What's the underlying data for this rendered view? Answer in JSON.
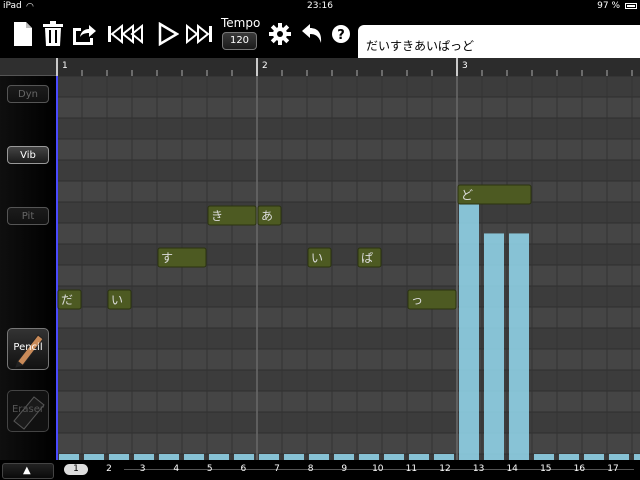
{
  "status": {
    "device": "iPad",
    "time": "23:16",
    "battery": "97 %"
  },
  "toolbar": {
    "tempo_label": "Tempo",
    "tempo_value": "120",
    "lyrics_value": "だいすきあいぱっど"
  },
  "sidebar": {
    "dyn": "Dyn",
    "vib": "Vib",
    "pit": "Pit",
    "pencil": "Pencil",
    "eraser": "Eraser"
  },
  "ruler": {
    "measures": [
      "1",
      "2",
      "3"
    ]
  },
  "notes": [
    {
      "char": "だ",
      "step": 0,
      "len": 1,
      "row": 10
    },
    {
      "char": "い",
      "step": 2,
      "len": 1,
      "row": 10
    },
    {
      "char": "す",
      "step": 4,
      "len": 2,
      "row": 8
    },
    {
      "char": "き",
      "step": 6,
      "len": 2,
      "row": 6
    },
    {
      "char": "あ",
      "step": 8,
      "len": 1,
      "row": 6
    },
    {
      "char": "い",
      "step": 10,
      "len": 1,
      "row": 8
    },
    {
      "char": "ぱ",
      "step": 12,
      "len": 1,
      "row": 8
    },
    {
      "char": "っ",
      "step": 14,
      "len": 2,
      "row": 10
    },
    {
      "char": "ど",
      "step": 16,
      "len": 3,
      "row": 5
    }
  ],
  "parameter_bars": {
    "note": "level per step, 0-1",
    "levels": [
      0.01,
      0.01,
      0.01,
      0.01,
      0.01,
      0.01,
      0.01,
      0.01,
      0.01,
      0.01,
      0.01,
      0.01,
      0.01,
      0.01,
      0.01,
      0.01,
      0.67,
      0.59,
      0.59,
      0.01,
      0.01,
      0.01,
      0.01,
      0.01
    ]
  },
  "pager": {
    "selected": "1",
    "pages": [
      "2",
      "3",
      "4",
      "5",
      "6",
      "7",
      "8",
      "9",
      "10",
      "11",
      "12",
      "13",
      "14",
      "15",
      "16",
      "17"
    ],
    "up_label": "▲"
  }
}
